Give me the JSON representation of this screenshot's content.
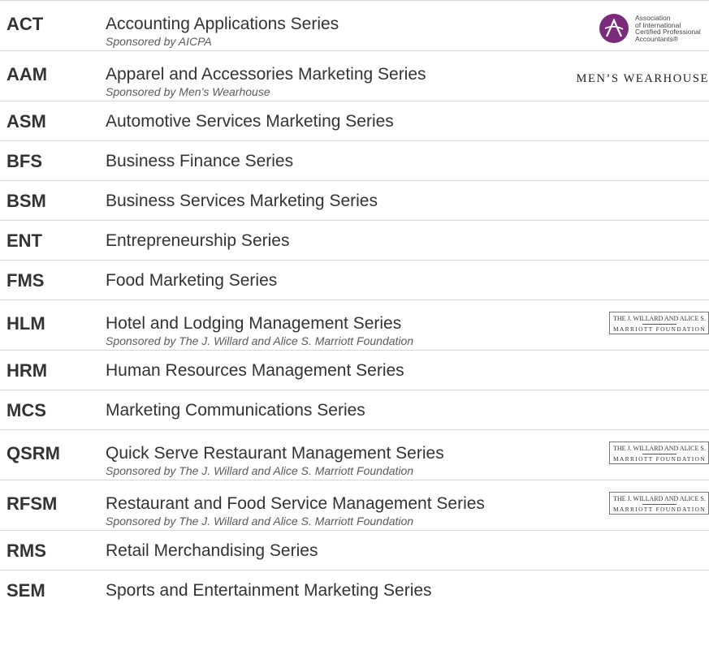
{
  "rows": [
    {
      "code": "ACT",
      "title": "Accounting Applications Series",
      "sponsor": "Sponsored by AICPA",
      "logo": "aicpa"
    },
    {
      "code": "AAM",
      "title": "Apparel and Accessories Marketing Series",
      "sponsor": "Sponsored by Men’s Wearhouse",
      "logo": "mens-wearhouse"
    },
    {
      "code": "ASM",
      "title": "Automotive Services Marketing Series"
    },
    {
      "code": "BFS",
      "title": "Business Finance Series"
    },
    {
      "code": "BSM",
      "title": "Business Services Marketing Series"
    },
    {
      "code": "ENT",
      "title": "Entrepreneurship Series"
    },
    {
      "code": "FMS",
      "title": "Food Marketing Series"
    },
    {
      "code": "HLM",
      "title": "Hotel and Lodging Management Series",
      "sponsor": "Sponsored by The J. Willard and Alice S. Marriott Foundation",
      "logo": "marriott"
    },
    {
      "code": "HRM",
      "title": "Human Resources Management Series"
    },
    {
      "code": "MCS",
      "title": "Marketing Communications Series"
    },
    {
      "code": "QSRM",
      "title": "Quick Serve Restaurant Management Series",
      "sponsor": "Sponsored by The J. Willard and Alice S. Marriott Foundation",
      "logo": "marriott"
    },
    {
      "code": "RFSM",
      "title": "Restaurant and Food Service Management Series",
      "sponsor": "Sponsored by The J. Willard and Alice S. Marriott Foundation",
      "logo": "marriott"
    },
    {
      "code": "RMS",
      "title": "Retail Merchandising Series"
    },
    {
      "code": "SEM",
      "title": "Sports and Entertainment Marketing Series"
    }
  ],
  "logos": {
    "aicpa": {
      "text": "Association\nof International\nCertified Professional\nAccountants®",
      "color": "#7a2c78"
    },
    "mens_wearhouse": {
      "text": "MEN’S WEARHOUSE"
    },
    "marriott": {
      "line1": "THE J. WILLARD AND ALICE S.",
      "line2": "MARRIOTT FOUNDATION"
    }
  }
}
